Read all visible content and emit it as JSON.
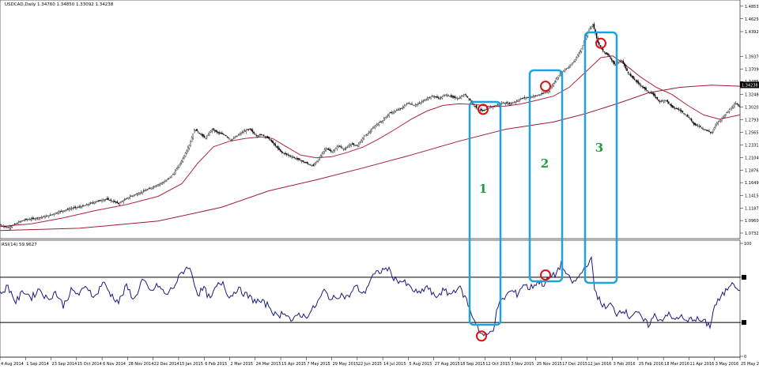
{
  "colors": {
    "candle": "#000000",
    "ma_fast": "#b0243a",
    "ma_slow": "#a01c30",
    "rsi": "#1a1a80",
    "highlight_box": "#1fa3d8",
    "marker": "#dd1111",
    "zone_label": "#1e9e3a"
  },
  "chart_data": [
    {
      "type": "candlestick",
      "symbol_header": "USDCAD,Daily  1.34760 1.34850 1.33092 1.34238",
      "price_ticks": [
        "1.48535",
        "1.46250",
        "1.43920",
        "1.39370",
        "1.37090",
        "1.34850",
        "1.32480",
        "1.30205",
        "1.27930",
        "1.25655",
        "1.23315",
        "1.21040",
        "1.18765",
        "1.16490",
        "1.14150",
        "1.11875",
        "1.09600",
        "1.07325"
      ],
      "current_price_label": "1.34238",
      "ylim": [
        1.0675,
        1.4909
      ],
      "date_ticks": [
        "4 Aug 2014",
        "1 Sep 2014",
        "23 Sep 2014",
        "15 Oct 2014",
        "6 Nov 2014",
        "28 Nov 2014",
        "22 Dec 2014",
        "15 Jan 2015",
        "6 Feb 2015",
        "2 Mar 2015",
        "24 Mar 2015",
        "15 Apr 2015",
        "7 May 2015",
        "29 May 2015",
        "22 Jun 2015",
        "14 Jul 2015",
        "5 Aug 2015",
        "27 Aug 2015",
        "18 Sep 2015",
        "12 Oct 2015",
        "3 Nov 2015",
        "25 Nov 2015",
        "17 Dec 2015",
        "12 Jan 2016",
        "3 Feb 2016",
        "25 Feb 2016",
        "18 Mar 2016",
        "11 Apr 2016",
        "3 May 2016",
        "25 May 2016"
      ],
      "price_path": [
        [
          0,
          1.088
        ],
        [
          10,
          1.083
        ],
        [
          20,
          1.09
        ],
        [
          30,
          1.097
        ],
        [
          45,
          1.1
        ],
        [
          60,
          1.104
        ],
        [
          75,
          1.112
        ],
        [
          90,
          1.118
        ],
        [
          105,
          1.122
        ],
        [
          120,
          1.13
        ],
        [
          135,
          1.135
        ],
        [
          150,
          1.127
        ],
        [
          165,
          1.14
        ],
        [
          180,
          1.148
        ],
        [
          195,
          1.158
        ],
        [
          210,
          1.168
        ],
        [
          220,
          1.182
        ],
        [
          230,
          1.205
        ],
        [
          240,
          1.235
        ],
        [
          246,
          1.262
        ],
        [
          252,
          1.255
        ],
        [
          260,
          1.245
        ],
        [
          268,
          1.262
        ],
        [
          276,
          1.255
        ],
        [
          284,
          1.252
        ],
        [
          292,
          1.242
        ],
        [
          300,
          1.25
        ],
        [
          308,
          1.258
        ],
        [
          316,
          1.262
        ],
        [
          324,
          1.25
        ],
        [
          332,
          1.252
        ],
        [
          340,
          1.245
        ],
        [
          348,
          1.232
        ],
        [
          356,
          1.22
        ],
        [
          364,
          1.215
        ],
        [
          372,
          1.21
        ],
        [
          380,
          1.205
        ],
        [
          388,
          1.2
        ],
        [
          396,
          1.195
        ],
        [
          404,
          1.21
        ],
        [
          412,
          1.228
        ],
        [
          420,
          1.22
        ],
        [
          428,
          1.232
        ],
        [
          436,
          1.225
        ],
        [
          444,
          1.235
        ],
        [
          452,
          1.232
        ],
        [
          460,
          1.248
        ],
        [
          468,
          1.258
        ],
        [
          476,
          1.27
        ],
        [
          484,
          1.278
        ],
        [
          492,
          1.29
        ],
        [
          500,
          1.295
        ],
        [
          508,
          1.3
        ],
        [
          516,
          1.31
        ],
        [
          524,
          1.305
        ],
        [
          532,
          1.31
        ],
        [
          540,
          1.318
        ],
        [
          548,
          1.322
        ],
        [
          556,
          1.318
        ],
        [
          564,
          1.325
        ],
        [
          572,
          1.32
        ],
        [
          580,
          1.318
        ],
        [
          588,
          1.325
        ],
        [
          596,
          1.312
        ],
        [
          604,
          1.298
        ],
        [
          612,
          1.295
        ],
        [
          620,
          1.302
        ],
        [
          628,
          1.305
        ],
        [
          636,
          1.31
        ],
        [
          644,
          1.308
        ],
        [
          652,
          1.312
        ],
        [
          660,
          1.318
        ],
        [
          668,
          1.32
        ],
        [
          676,
          1.322
        ],
        [
          684,
          1.325
        ],
        [
          692,
          1.33
        ],
        [
          698,
          1.34
        ],
        [
          704,
          1.355
        ],
        [
          712,
          1.368
        ],
        [
          720,
          1.375
        ],
        [
          728,
          1.39
        ],
        [
          736,
          1.41
        ],
        [
          744,
          1.44
        ],
        [
          750,
          1.452
        ],
        [
          756,
          1.42
        ],
        [
          762,
          1.405
        ],
        [
          770,
          1.395
        ],
        [
          778,
          1.378
        ],
        [
          786,
          1.388
        ],
        [
          794,
          1.365
        ],
        [
          802,
          1.352
        ],
        [
          810,
          1.342
        ],
        [
          818,
          1.332
        ],
        [
          826,
          1.325
        ],
        [
          834,
          1.312
        ],
        [
          842,
          1.315
        ],
        [
          850,
          1.302
        ],
        [
          858,
          1.298
        ],
        [
          866,
          1.29
        ],
        [
          872,
          1.282
        ],
        [
          878,
          1.27
        ],
        [
          884,
          1.268
        ],
        [
          890,
          1.262
        ],
        [
          896,
          1.258
        ],
        [
          900,
          1.255
        ],
        [
          906,
          1.272
        ],
        [
          912,
          1.28
        ],
        [
          918,
          1.29
        ],
        [
          924,
          1.3
        ],
        [
          930,
          1.31
        ],
        [
          936,
          1.302
        ]
      ],
      "ma_fast": [
        [
          0,
          1.085
        ],
        [
          40,
          1.09
        ],
        [
          80,
          1.101
        ],
        [
          120,
          1.114
        ],
        [
          160,
          1.125
        ],
        [
          200,
          1.14
        ],
        [
          230,
          1.163
        ],
        [
          250,
          1.2
        ],
        [
          270,
          1.23
        ],
        [
          290,
          1.24
        ],
        [
          310,
          1.245
        ],
        [
          330,
          1.248
        ],
        [
          345,
          1.245
        ],
        [
          360,
          1.232
        ],
        [
          380,
          1.215
        ],
        [
          400,
          1.21
        ],
        [
          420,
          1.212
        ],
        [
          440,
          1.22
        ],
        [
          460,
          1.23
        ],
        [
          480,
          1.245
        ],
        [
          500,
          1.262
        ],
        [
          520,
          1.28
        ],
        [
          540,
          1.295
        ],
        [
          560,
          1.305
        ],
        [
          580,
          1.308
        ],
        [
          600,
          1.307
        ],
        [
          620,
          1.303
        ],
        [
          640,
          1.304
        ],
        [
          660,
          1.308
        ],
        [
          680,
          1.315
        ],
        [
          700,
          1.322
        ],
        [
          720,
          1.338
        ],
        [
          740,
          1.365
        ],
        [
          760,
          1.392
        ],
        [
          775,
          1.395
        ],
        [
          790,
          1.38
        ],
        [
          810,
          1.357
        ],
        [
          830,
          1.338
        ],
        [
          850,
          1.325
        ],
        [
          870,
          1.305
        ],
        [
          890,
          1.288
        ],
        [
          910,
          1.28
        ],
        [
          936,
          1.288
        ]
      ],
      "ma_slow": [
        [
          0,
          1.078
        ],
        [
          100,
          1.082
        ],
        [
          200,
          1.095
        ],
        [
          280,
          1.12
        ],
        [
          340,
          1.15
        ],
        [
          400,
          1.17
        ],
        [
          460,
          1.192
        ],
        [
          520,
          1.215
        ],
        [
          580,
          1.24
        ],
        [
          640,
          1.262
        ],
        [
          700,
          1.275
        ],
        [
          740,
          1.29
        ],
        [
          780,
          1.308
        ],
        [
          820,
          1.328
        ],
        [
          860,
          1.338
        ],
        [
          900,
          1.342
        ],
        [
          936,
          1.34
        ]
      ]
    },
    {
      "type": "line",
      "indicator_label": "RSI(14) 59.9627",
      "ylim": [
        0,
        100
      ],
      "y_ticks": [
        "100",
        "70",
        "30",
        "0"
      ],
      "levels": [
        70,
        30
      ],
      "rsi_path": [
        [
          0,
          55
        ],
        [
          10,
          62
        ],
        [
          20,
          48
        ],
        [
          30,
          58
        ],
        [
          40,
          52
        ],
        [
          50,
          60
        ],
        [
          60,
          50
        ],
        [
          70,
          57
        ],
        [
          80,
          45
        ],
        [
          90,
          58
        ],
        [
          100,
          55
        ],
        [
          110,
          62
        ],
        [
          120,
          52
        ],
        [
          130,
          66
        ],
        [
          140,
          55
        ],
        [
          150,
          48
        ],
        [
          160,
          62
        ],
        [
          170,
          50
        ],
        [
          180,
          68
        ],
        [
          190,
          57
        ],
        [
          200,
          63
        ],
        [
          210,
          54
        ],
        [
          220,
          62
        ],
        [
          230,
          74
        ],
        [
          238,
          80
        ],
        [
          244,
          70
        ],
        [
          250,
          55
        ],
        [
          258,
          60
        ],
        [
          266,
          50
        ],
        [
          274,
          62
        ],
        [
          282,
          66
        ],
        [
          290,
          52
        ],
        [
          300,
          60
        ],
        [
          310,
          55
        ],
        [
          320,
          50
        ],
        [
          330,
          48
        ],
        [
          340,
          45
        ],
        [
          350,
          35
        ],
        [
          360,
          40
        ],
        [
          370,
          30
        ],
        [
          378,
          38
        ],
        [
          386,
          35
        ],
        [
          394,
          40
        ],
        [
          402,
          48
        ],
        [
          410,
          58
        ],
        [
          420,
          50
        ],
        [
          430,
          55
        ],
        [
          440,
          52
        ],
        [
          450,
          62
        ],
        [
          460,
          55
        ],
        [
          470,
          70
        ],
        [
          480,
          75
        ],
        [
          490,
          78
        ],
        [
          500,
          68
        ],
        [
          510,
          66
        ],
        [
          520,
          60
        ],
        [
          530,
          55
        ],
        [
          540,
          62
        ],
        [
          550,
          52
        ],
        [
          560,
          58
        ],
        [
          570,
          55
        ],
        [
          580,
          62
        ],
        [
          590,
          50
        ],
        [
          596,
          38
        ],
        [
          602,
          30
        ],
        [
          608,
          20
        ],
        [
          616,
          18
        ],
        [
          624,
          25
        ],
        [
          630,
          45
        ],
        [
          638,
          52
        ],
        [
          646,
          58
        ],
        [
          654,
          55
        ],
        [
          662,
          64
        ],
        [
          670,
          60
        ],
        [
          680,
          66
        ],
        [
          688,
          64
        ],
        [
          696,
          70
        ],
        [
          702,
          72
        ],
        [
          710,
          82
        ],
        [
          718,
          70
        ],
        [
          726,
          65
        ],
        [
          734,
          72
        ],
        [
          742,
          82
        ],
        [
          748,
          85
        ],
        [
          752,
          60
        ],
        [
          758,
          50
        ],
        [
          766,
          42
        ],
        [
          772,
          46
        ],
        [
          780,
          38
        ],
        [
          788,
          42
        ],
        [
          796,
          35
        ],
        [
          804,
          40
        ],
        [
          812,
          33
        ],
        [
          820,
          28
        ],
        [
          828,
          36
        ],
        [
          836,
          32
        ],
        [
          844,
          38
        ],
        [
          852,
          32
        ],
        [
          860,
          36
        ],
        [
          868,
          30
        ],
        [
          876,
          34
        ],
        [
          884,
          32
        ],
        [
          892,
          30
        ],
        [
          898,
          27
        ],
        [
          904,
          45
        ],
        [
          912,
          52
        ],
        [
          920,
          60
        ],
        [
          926,
          67
        ],
        [
          932,
          62
        ],
        [
          936,
          56
        ]
      ]
    }
  ],
  "annotations": [
    {
      "label": "1",
      "marker_price": 1.298,
      "marker_rsi": 18
    },
    {
      "label": "2",
      "marker_price": 1.34,
      "marker_rsi": 72
    },
    {
      "label": "3",
      "marker_price": 1.418,
      "marker_rsi": null
    }
  ]
}
